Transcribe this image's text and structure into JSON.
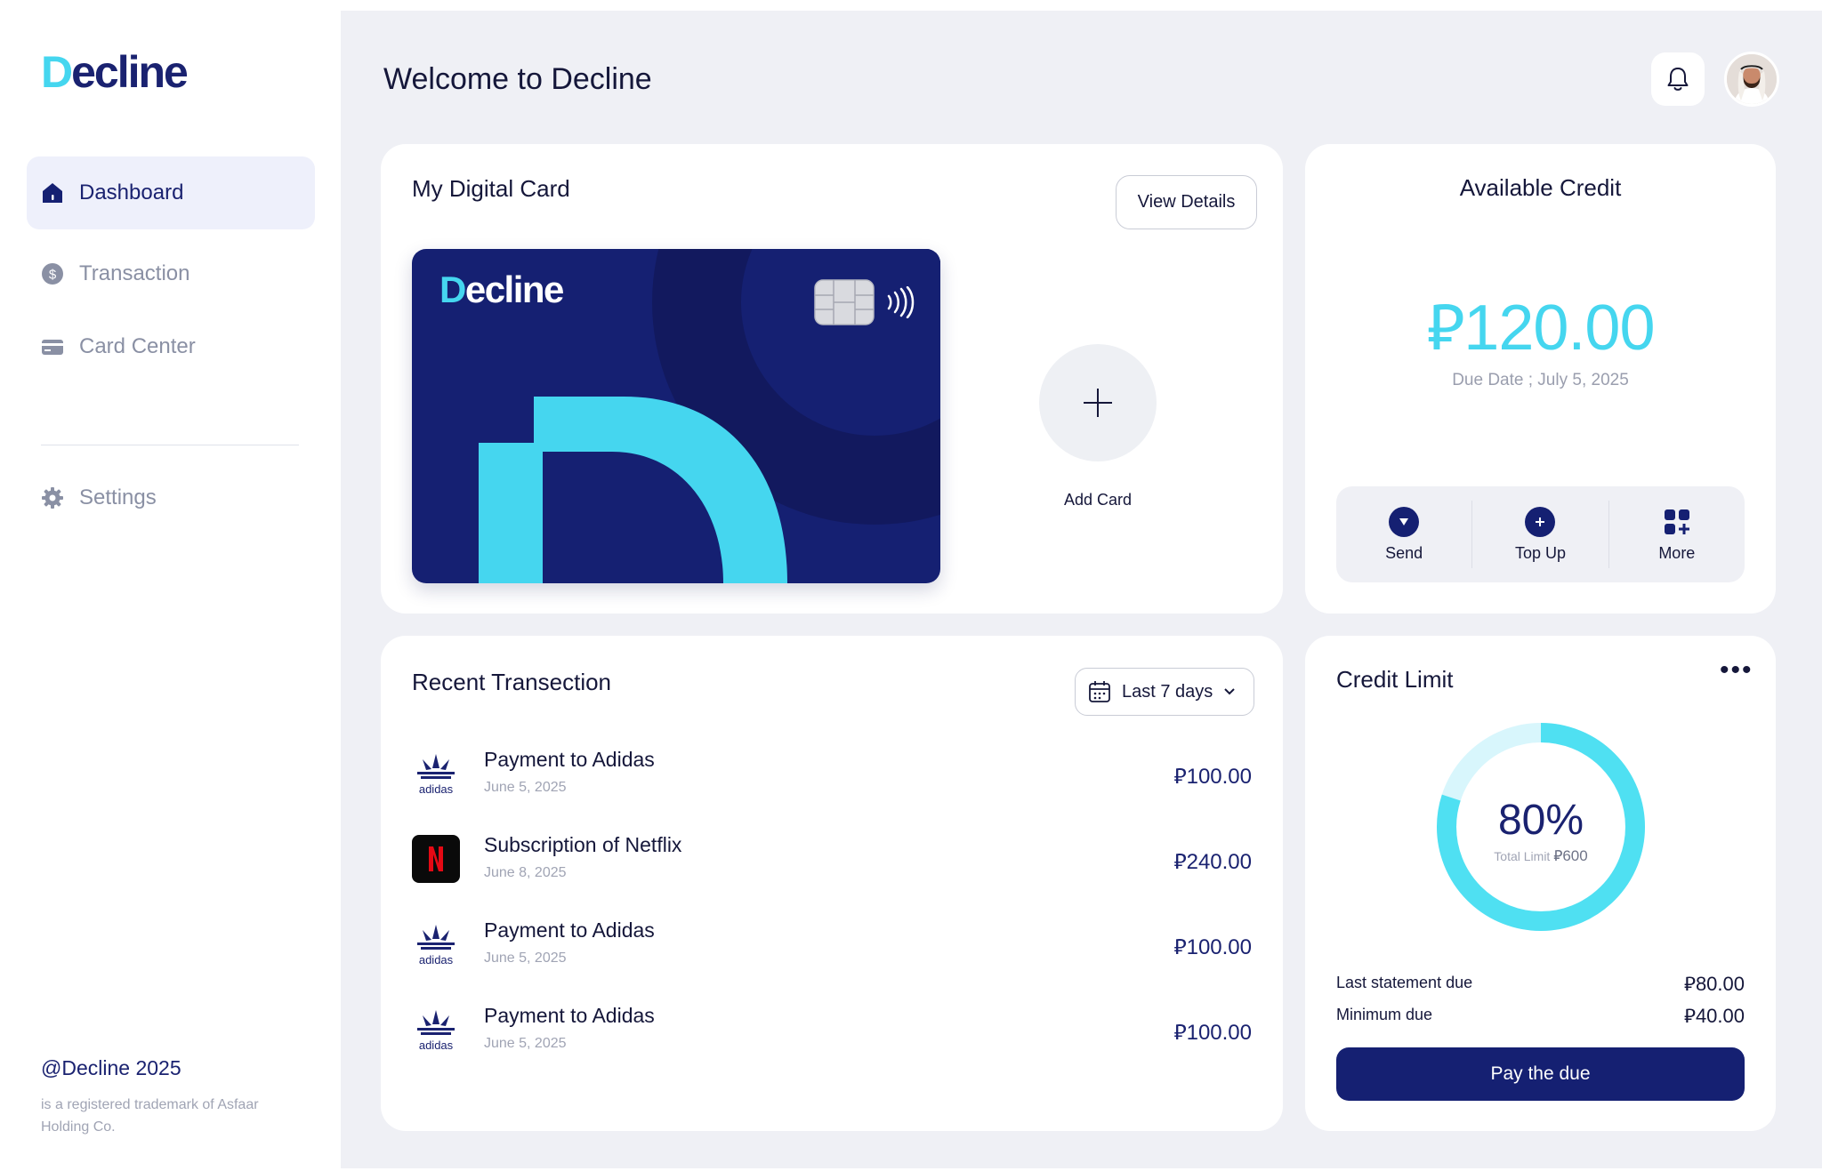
{
  "brand": {
    "name": "Decline",
    "logo_first": "D",
    "logo_rest": "ecline"
  },
  "sidebar": {
    "items": [
      {
        "label": "Dashboard",
        "icon": "home-icon",
        "active": true
      },
      {
        "label": "Transaction",
        "icon": "dollar-circle-icon",
        "active": false
      },
      {
        "label": "Card Center",
        "icon": "credit-card-icon",
        "active": false
      }
    ],
    "settings_label": "Settings",
    "footer_title": "@Decline 2025",
    "footer_text": "is a registered trademark of Asfaar Holding Co."
  },
  "header": {
    "title": "Welcome to Decline",
    "icons": [
      "bell-icon",
      "avatar"
    ]
  },
  "digital_card": {
    "title": "My Digital Card",
    "view_details": "View Details",
    "card_logo_first": "D",
    "card_logo_rest": "ecline",
    "add_card_label": "Add Card"
  },
  "available_credit": {
    "title": "Available Credit",
    "currency": "⃁",
    "amount": "120.00",
    "due_date": "Due Date ; July 5, 2025",
    "actions": [
      {
        "label": "Send",
        "icon": "send-icon"
      },
      {
        "label": "Top Up",
        "icon": "plus-icon"
      },
      {
        "label": "More",
        "icon": "grid-icon"
      }
    ]
  },
  "recent": {
    "title": "Recent Transection",
    "range": "Last 7 days",
    "transactions": [
      {
        "name": "Payment to Adidas",
        "date": "June 5, 2025",
        "amount": "100.00",
        "logo": "adidas-logo"
      },
      {
        "name": "Subscription of Netflix",
        "date": "June 8, 2025",
        "amount": "240.00",
        "logo": "netflix-logo"
      },
      {
        "name": "Payment to Adidas",
        "date": "June 5, 2025",
        "amount": "100.00",
        "logo": "adidas-logo"
      },
      {
        "name": "Payment to Adidas",
        "date": "June 5, 2025",
        "amount": "100.00",
        "logo": "adidas-logo"
      }
    ]
  },
  "credit_limit": {
    "title": "Credit Limit",
    "percent": "80%",
    "percent_value": 0.8,
    "total_limit_label": "Total Limit",
    "total_limit": "600",
    "last_statement_label": "Last statement due",
    "last_statement_value": "80.00",
    "minimum_due_label": "Minimum due",
    "minimum_due_value": "40.00",
    "pay_label": "Pay the due"
  },
  "colors": {
    "navy": "#152072",
    "cyan": "#45d6ef",
    "bg": "#eff0f5"
  }
}
